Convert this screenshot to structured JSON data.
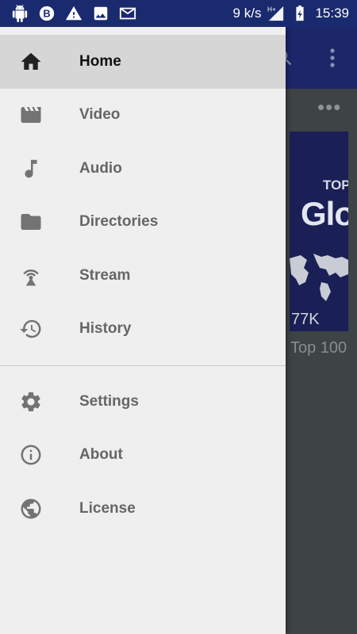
{
  "status_bar": {
    "speed": "9 k/s",
    "network": "H+",
    "time": "15:39",
    "icons": [
      "android-icon",
      "b-circle-icon",
      "warning-icon",
      "image-icon",
      "mail-icon"
    ]
  },
  "background": {
    "thumbnail_top_text": "TOP",
    "thumbnail_big_text": "Glo",
    "thumbnail_views": "77K",
    "thumbnail_title": "Top 100"
  },
  "drawer": {
    "primary_items": [
      {
        "label": "Home",
        "icon": "home-icon",
        "active": true
      },
      {
        "label": "Video",
        "icon": "movie-clapper-icon",
        "active": false
      },
      {
        "label": "Audio",
        "icon": "music-note-icon",
        "active": false
      },
      {
        "label": "Directories",
        "icon": "folder-icon",
        "active": false
      },
      {
        "label": "Stream",
        "icon": "antenna-icon",
        "active": false
      },
      {
        "label": "History",
        "icon": "history-icon",
        "active": false
      }
    ],
    "secondary_items": [
      {
        "label": "Settings",
        "icon": "gear-icon"
      },
      {
        "label": "About",
        "icon": "info-icon"
      },
      {
        "label": "License",
        "icon": "globe-icon"
      }
    ]
  },
  "colors": {
    "status_bar": "#1a2a6e",
    "drawer_bg": "#efefef",
    "active_item_bg": "#d6d6d6",
    "overlay": "#3e4345"
  }
}
